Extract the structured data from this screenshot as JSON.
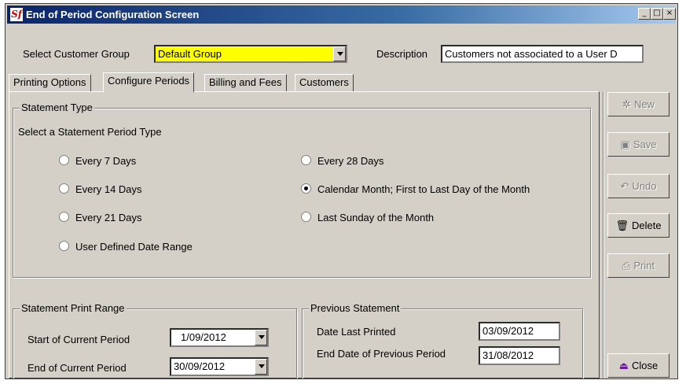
{
  "window": {
    "title": "End of Period Configuration Screen",
    "logo_text": "Sf",
    "minimize": "_",
    "maximize": "□",
    "close": "×"
  },
  "header": {
    "customer_group_label": "Select Customer Group",
    "customer_group_value": "Default Group",
    "description_label": "Description",
    "description_value": "Customers not associated to a User D"
  },
  "tabs": [
    {
      "label": "Printing Options"
    },
    {
      "label": "Configure Periods"
    },
    {
      "label": "Billing and Fees"
    },
    {
      "label": "Customers"
    }
  ],
  "statement_type": {
    "legend": "Statement Type",
    "prompt": "Select a Statement Period Type",
    "options": [
      {
        "label": "Every 7 Days",
        "selected": false
      },
      {
        "label": "Every 14 Days",
        "selected": false
      },
      {
        "label": "Every 21 Days",
        "selected": false
      },
      {
        "label": "User Defined Date Range",
        "selected": false
      },
      {
        "label": "Every 28 Days",
        "selected": false
      },
      {
        "label": "Calendar Month; First to Last Day of the Month",
        "selected": true
      },
      {
        "label": "Last Sunday of the Month",
        "selected": false
      }
    ]
  },
  "print_range": {
    "legend": "Statement Print Range",
    "start_label": "Start of Current Period",
    "start_value": "1/09/2012",
    "end_label": "End of Current Period",
    "end_value": "30/09/2012"
  },
  "previous_statement": {
    "legend": "Previous Statement",
    "date_last_printed_label": "Date Last Printed",
    "date_last_printed_value": "03/09/2012",
    "end_prev_label": "End Date of Previous Period",
    "end_prev_value": "31/08/2012"
  },
  "side_buttons": {
    "new": "New",
    "save": "Save",
    "undo": "Undo",
    "delete": "Delete",
    "print": "Print",
    "close": "Close"
  },
  "colors": {
    "highlight": "#ffff00",
    "face": "#d4d0c8",
    "title_start": "#0a246a"
  }
}
